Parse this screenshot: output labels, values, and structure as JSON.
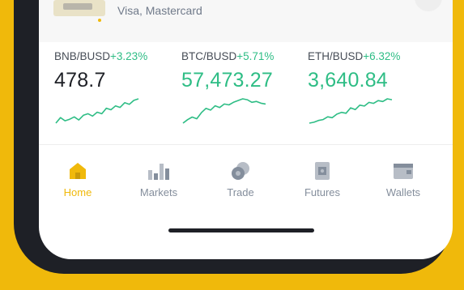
{
  "payment": {
    "methods_text": "Visa, Mastercard"
  },
  "tickers": [
    {
      "pair": "BNB/BUSD",
      "change": "+3.23%",
      "price": "478.7",
      "price_color": "#1e2026",
      "spark": [
        2,
        9,
        5,
        7,
        10,
        6,
        12,
        14,
        11,
        16,
        14,
        21,
        19,
        24,
        22,
        28,
        26,
        31,
        33
      ]
    },
    {
      "pair": "BTC/BUSD",
      "change": "+5.71%",
      "price": "57,473.27",
      "price_color": "#2ebd85",
      "spark": [
        2,
        6,
        9,
        7,
        14,
        19,
        17,
        22,
        20,
        24,
        23,
        26,
        28,
        30,
        29,
        26,
        27,
        25,
        24
      ]
    },
    {
      "pair": "ETH/BUSD",
      "change": "+6.32%",
      "price": "3,640.84",
      "price_color": "#2ebd85",
      "spark": [
        2,
        3,
        5,
        6,
        9,
        8,
        12,
        14,
        13,
        19,
        17,
        22,
        21,
        25,
        24,
        27,
        26,
        29,
        28
      ]
    }
  ],
  "nav": {
    "active_color": "#f0b90b",
    "inactive_color": "#848e9c",
    "items": [
      {
        "label": "Home",
        "icon": "home-icon",
        "active": true
      },
      {
        "label": "Markets",
        "icon": "markets-icon",
        "active": false
      },
      {
        "label": "Trade",
        "icon": "trade-icon",
        "active": false
      },
      {
        "label": "Futures",
        "icon": "futures-icon",
        "active": false
      },
      {
        "label": "Wallets",
        "icon": "wallet-icon",
        "active": false
      }
    ]
  }
}
